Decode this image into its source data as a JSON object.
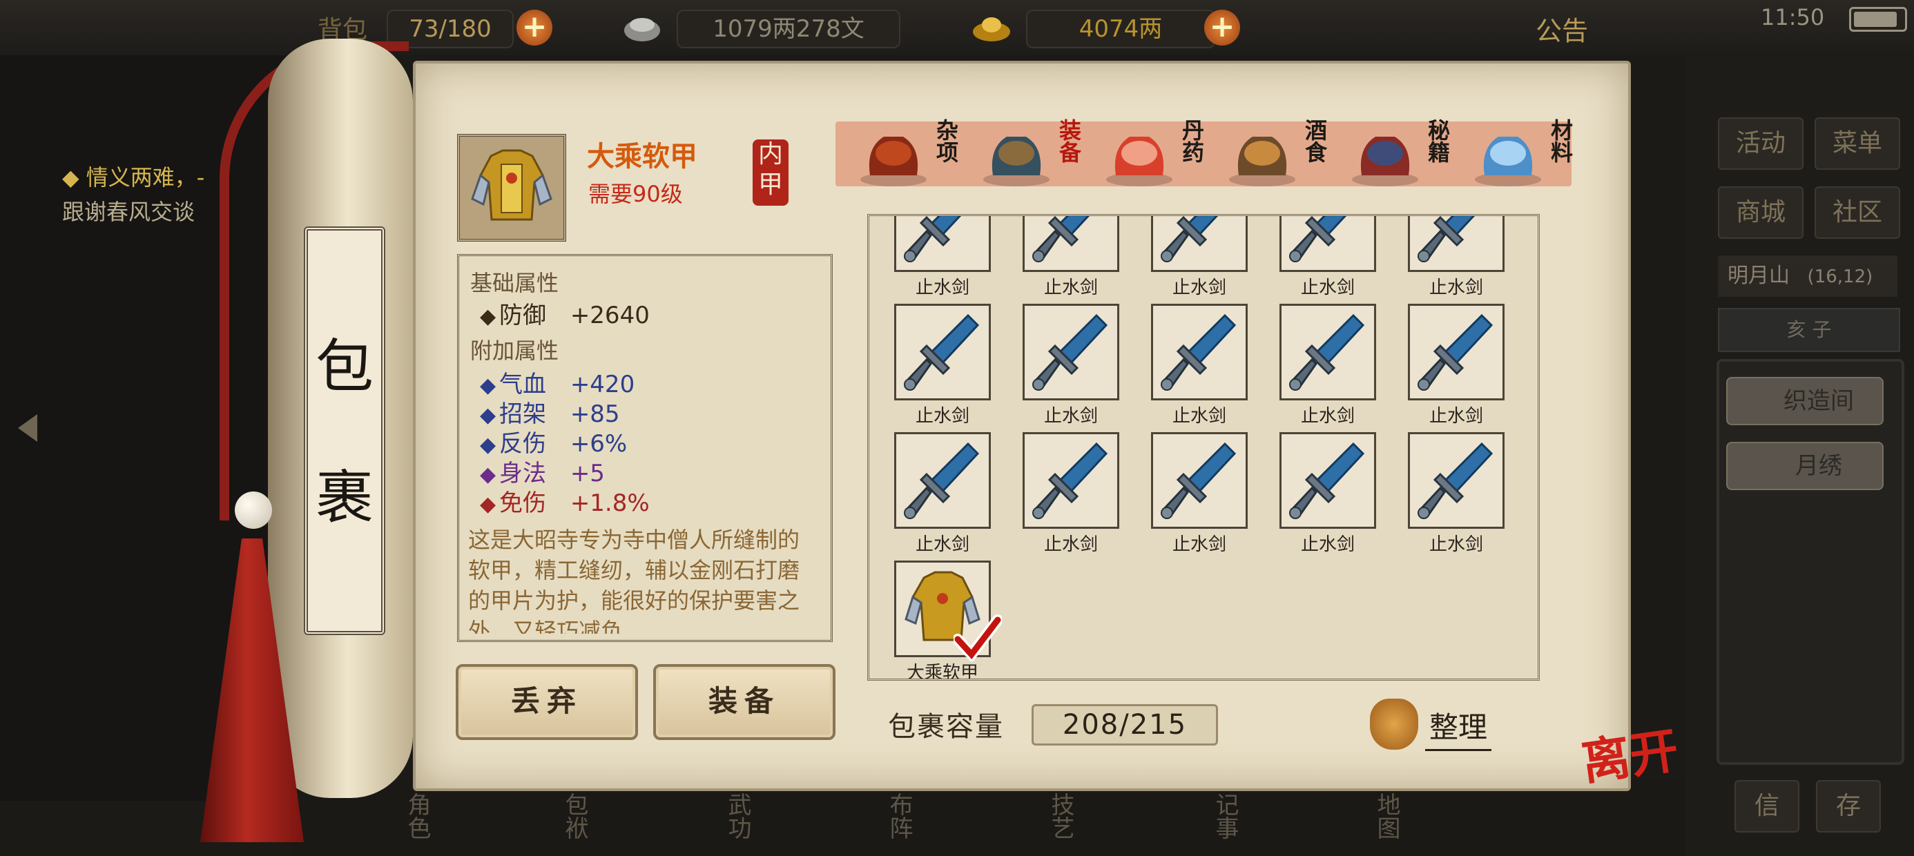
{
  "topbar": {
    "bag_partial": "背包",
    "bag_count": "73/180",
    "silver": "1079两278文",
    "gold": "4074两",
    "announce": "公告",
    "time": "11:50"
  },
  "quest": {
    "title": "◆ 情义两难，-",
    "desc": "跟谢春风交谈"
  },
  "right": {
    "activity": "活动",
    "menu": "菜单",
    "shop": "商城",
    "community": "社区",
    "location": "明月山",
    "coords": "(16,12)",
    "time_label": "亥 子",
    "weave_room": "织造间",
    "embroidery": "月绣",
    "bottom_left": "信",
    "bottom_right": "存"
  },
  "nav": [
    "角色",
    "包袱",
    "武功",
    "布阵",
    "技艺",
    "记事",
    "地图"
  ],
  "scroll_title": [
    "包",
    "裹"
  ],
  "item": {
    "name": "大乘软甲",
    "level_req": "需要90级",
    "type_seal": "内甲",
    "base_header": "基础属性",
    "base_stats": [
      {
        "name": "防御",
        "value": "+2640",
        "color": "#3a2a1a"
      }
    ],
    "extra_header": "附加属性",
    "extra_stats": [
      {
        "name": "气血",
        "value": "+420",
        "color": "#2d3e8c"
      },
      {
        "name": "招架",
        "value": "+85",
        "color": "#2d3e8c"
      },
      {
        "name": "反伤",
        "value": "+6%",
        "color": "#2d3e8c"
      },
      {
        "name": "身法",
        "value": "+5",
        "color": "#6b2c8a"
      },
      {
        "name": "免伤",
        "value": "+1.8%",
        "color": "#a32626"
      }
    ],
    "description": "这是大昭寺专为寺中僧人所缝制的软甲，精工缝纫，辅以金刚石打磨的甲片为护，能很好的保护要害之外，又轻巧减负"
  },
  "buttons": {
    "discard": "丢弃",
    "equip": "装备"
  },
  "tabs": [
    {
      "label": "杂项",
      "icon": "jar-icon",
      "active": false
    },
    {
      "label": "装备",
      "icon": "equipment-icon",
      "active": true
    },
    {
      "label": "丹药",
      "icon": "pill-icon",
      "active": false
    },
    {
      "label": "酒食",
      "icon": "food-icon",
      "active": false
    },
    {
      "label": "秘籍",
      "icon": "book-icon",
      "active": false
    },
    {
      "label": "材料",
      "icon": "crystal-icon",
      "active": false
    }
  ],
  "inventory": {
    "items": [
      {
        "name": "止水剑",
        "icon": "sword-icon"
      },
      {
        "name": "止水剑",
        "icon": "sword-icon"
      },
      {
        "name": "止水剑",
        "icon": "sword-icon"
      },
      {
        "name": "止水剑",
        "icon": "sword-icon"
      },
      {
        "name": "止水剑",
        "icon": "sword-icon"
      },
      {
        "name": "止水剑",
        "icon": "sword-icon"
      },
      {
        "name": "止水剑",
        "icon": "sword-icon"
      },
      {
        "name": "止水剑",
        "icon": "sword-icon"
      },
      {
        "name": "止水剑",
        "icon": "sword-icon"
      },
      {
        "name": "止水剑",
        "icon": "sword-icon"
      },
      {
        "name": "止水剑",
        "icon": "sword-icon"
      },
      {
        "name": "止水剑",
        "icon": "sword-icon"
      },
      {
        "name": "止水剑",
        "icon": "sword-icon"
      },
      {
        "name": "止水剑",
        "icon": "sword-icon"
      },
      {
        "name": "止水剑",
        "icon": "sword-icon"
      },
      {
        "name": "大乘软甲",
        "icon": "armor-icon",
        "selected": true
      }
    ],
    "capacity_label": "包裹容量",
    "capacity": "208/215",
    "sort_label": "整理"
  },
  "leave": "离开"
}
